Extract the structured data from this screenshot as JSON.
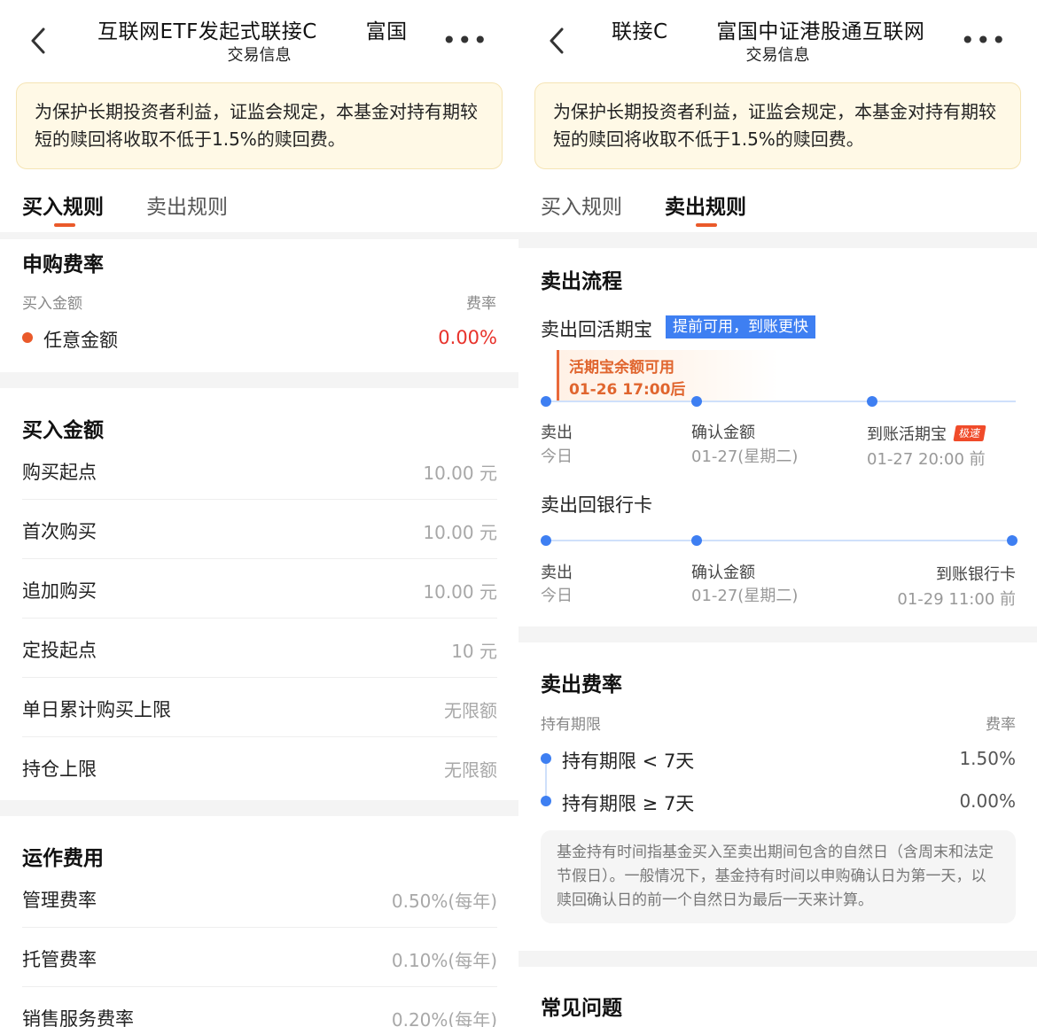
{
  "left": {
    "header": {
      "title": "互联网ETF发起式联接C　　 富国",
      "subtitle": "交易信息",
      "more": "•••"
    },
    "notice": {
      "text": "为保护长期投资者利益，证监会规定，本基金对持有期较短的赎回将收取不低于1.5%的赎回费。"
    },
    "tabs": [
      {
        "label": "买入规则",
        "active": true
      },
      {
        "label": "卖出规则",
        "active": false
      }
    ],
    "fee_section": {
      "title": "申购费率",
      "col_amount": "买入金额",
      "col_rate": "费率",
      "rows": [
        {
          "label": "任意金额",
          "rate": "0.00%"
        }
      ]
    },
    "amount_section": {
      "title": "买入金额",
      "rows": [
        {
          "label": "购买起点",
          "value": "10.00 元"
        },
        {
          "label": "首次购买",
          "value": "10.00 元"
        },
        {
          "label": "追加购买",
          "value": "10.00 元"
        },
        {
          "label": "定投起点",
          "value": "10 元"
        },
        {
          "label": "单日累计购买上限",
          "value": "无限额"
        },
        {
          "label": "持仓上限",
          "value": "无限额"
        }
      ]
    },
    "ops_section": {
      "title": "运作费用",
      "rows": [
        {
          "label": "管理费率",
          "value": "0.50%(每年)"
        },
        {
          "label": "托管费率",
          "value": "0.10%(每年)"
        },
        {
          "label": "销售服务费率",
          "value": "0.20%(每年)"
        }
      ]
    }
  },
  "right": {
    "header": {
      "title": "联接C　　 富国中证港股通互联网",
      "subtitle": "交易信息",
      "more": "•••"
    },
    "notice": {
      "text": "为保护长期投资者利益，证监会规定，本基金对持有期较短的赎回将收取不低于1.5%的赎回费。"
    },
    "tabs": [
      {
        "label": "买入规则",
        "active": false
      },
      {
        "label": "卖出规则",
        "active": true
      }
    ],
    "flow_section": {
      "title": "卖出流程",
      "huoqi": {
        "title": "卖出回活期宝",
        "badge": "提前可用，到账更快",
        "tip_line1": "活期宝余额可用",
        "tip_line2": "01-26 17:00后",
        "steps": [
          {
            "label": "卖出",
            "sub": "今日"
          },
          {
            "label": "确认金额",
            "sub": "01-27(星期二)"
          },
          {
            "label": "到账活期宝",
            "sub": "01-27 20:00 前",
            "badge": "极速"
          }
        ]
      },
      "bank": {
        "title": "卖出回银行卡",
        "steps": [
          {
            "label": "卖出",
            "sub": "今日"
          },
          {
            "label": "确认金额",
            "sub": "01-27(星期二)"
          },
          {
            "label": "到账银行卡",
            "sub": "01-29 11:00 前"
          }
        ]
      }
    },
    "fee_section": {
      "title": "卖出费率",
      "col_period": "持有期限",
      "col_rate": "费率",
      "rows": [
        {
          "label": "持有期限 < 7天",
          "rate": "1.50%"
        },
        {
          "label": "持有期限 ≥ 7天",
          "rate": "0.00%"
        }
      ],
      "note": "基金持有时间指基金买入至卖出期间包含的自然日（含周末和法定节假日）。一般情况下，基金持有时间以申购确认日为第一天，以赎回确认日的前一个自然日为最后一天来计算。"
    },
    "faq": {
      "title": "常见问题"
    }
  },
  "colors": {
    "accent": "#ea5a2a",
    "blue": "#3e7ff2",
    "rate_red": "#e8322b",
    "notice_bg": "#fff9e6"
  }
}
